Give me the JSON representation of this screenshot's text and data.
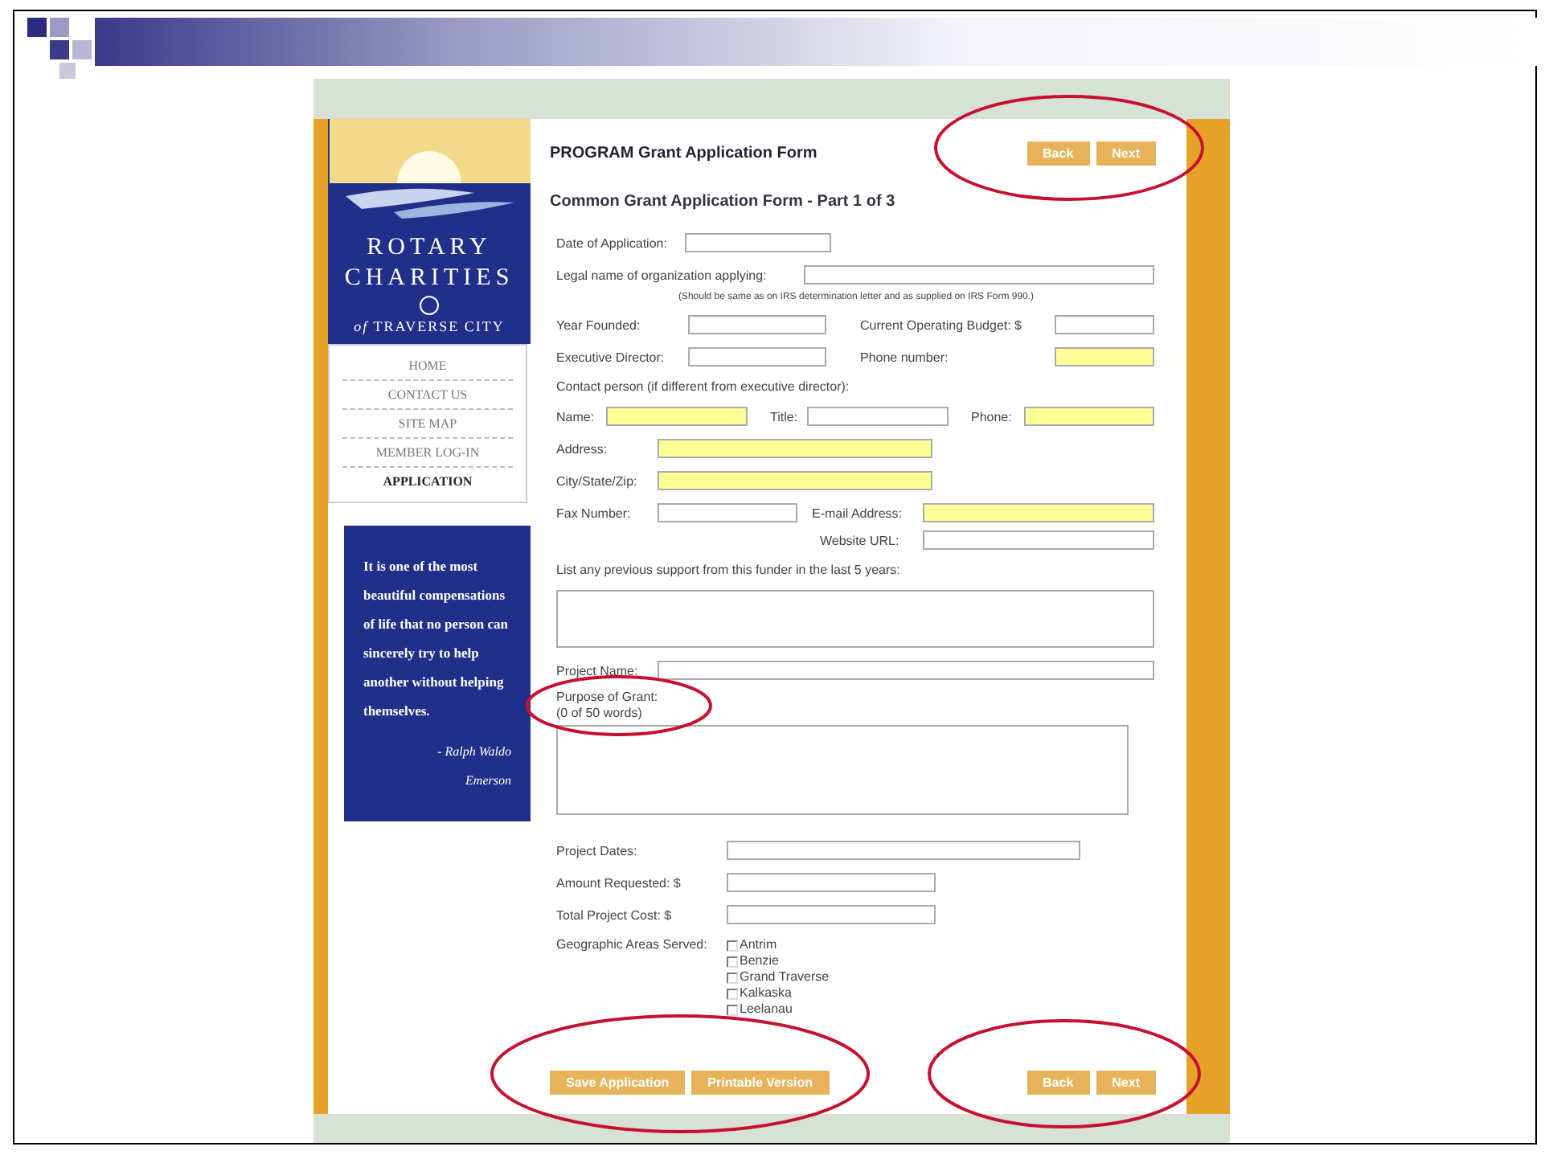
{
  "site": {
    "logo": {
      "line1": "ROTARY",
      "line2": "CHARITIES",
      "line3": "*of* TRAVERSE CITY"
    },
    "nav": [
      {
        "label": "HOME",
        "selected": false
      },
      {
        "label": "CONTACT US",
        "selected": false
      },
      {
        "label": "SITE MAP",
        "selected": false
      },
      {
        "label": "MEMBER LOG-IN",
        "selected": false
      },
      {
        "label": "APPLICATION",
        "selected": true
      }
    ],
    "quote": {
      "text": "It is one of the most beautiful compensations of life that no person can sincerely try to help another without helping themselves.",
      "author": "- Ralph Waldo Emerson"
    }
  },
  "form": {
    "title": "PROGRAM Grant Application Form",
    "top_buttons": [
      "Back",
      "Next"
    ],
    "subtitle": "Common Grant Application Form - Part 1 of 3",
    "rows": [
      {
        "kind": "date",
        "items": [
          {
            "kind": "label",
            "text": "Date of Application:"
          },
          {
            "kind": "field",
            "highlighted": false
          }
        ]
      },
      {
        "kind": "legal",
        "items": [
          {
            "kind": "label",
            "text": "Legal name of organization applying:"
          },
          {
            "kind": "field",
            "highlighted": false
          }
        ]
      },
      {
        "kind": "note",
        "items": [
          {
            "kind": "note",
            "text": "(Should be same as on IRS determination letter and as supplied on IRS Form 990.)"
          }
        ]
      },
      {
        "kind": "pair",
        "items": [
          {
            "kind": "label",
            "text": "Year Founded:"
          },
          {
            "kind": "field",
            "highlighted": false
          },
          {
            "kind": "label",
            "text": "Current Operating Budget: $"
          },
          {
            "kind": "field",
            "highlighted": false
          }
        ]
      },
      {
        "kind": "pair",
        "items": [
          {
            "kind": "label",
            "text": "Executive Director:"
          },
          {
            "kind": "field",
            "highlighted": false
          },
          {
            "kind": "label",
            "text": "Phone number:"
          },
          {
            "kind": "field",
            "highlighted": true
          }
        ]
      },
      {
        "kind": "caption",
        "items": [
          {
            "kind": "label",
            "text": "Contact person (if different from executive director):"
          }
        ]
      },
      {
        "kind": "contact",
        "items": [
          {
            "kind": "label",
            "text": "Name:"
          },
          {
            "kind": "field",
            "highlighted": true
          },
          {
            "kind": "label",
            "text": "Title:"
          },
          {
            "kind": "field",
            "highlighted": false
          },
          {
            "kind": "label",
            "text": "Phone:"
          },
          {
            "kind": "field",
            "highlighted": true
          }
        ]
      },
      {
        "kind": "address",
        "items": [
          {
            "kind": "label",
            "text": "Address:"
          },
          {
            "kind": "field",
            "highlighted": true
          }
        ]
      },
      {
        "kind": "address",
        "items": [
          {
            "kind": "label",
            "text": "City/State/Zip:"
          },
          {
            "kind": "field",
            "highlighted": true
          }
        ]
      },
      {
        "kind": "fax",
        "items": [
          {
            "kind": "label",
            "text": "Fax Number:"
          },
          {
            "kind": "field",
            "highlighted": false
          },
          {
            "kind": "label",
            "text": "E-mail Address:"
          },
          {
            "kind": "field",
            "highlighted": true
          }
        ]
      },
      {
        "kind": "website",
        "items": [
          {
            "kind": "label",
            "text": "Website URL:"
          },
          {
            "kind": "field",
            "highlighted": false
          }
        ]
      },
      {
        "kind": "caption",
        "items": [
          {
            "kind": "label",
            "text": "List any previous support from this funder in the last 5 years:"
          }
        ]
      },
      {
        "kind": "support-box",
        "items": [
          {
            "kind": "textarea"
          }
        ]
      },
      {
        "kind": "address",
        "items": [
          {
            "kind": "label",
            "text": "Project Name:"
          },
          {
            "kind": "field",
            "highlighted": false
          }
        ]
      },
      {
        "kind": "purpose",
        "items": [
          {
            "kind": "label",
            "text": "Purpose of Grant:"
          },
          {
            "kind": "label",
            "text": "(0 of 50 words)"
          }
        ]
      },
      {
        "kind": "purpose-box",
        "items": [
          {
            "kind": "textarea"
          }
        ]
      },
      {
        "kind": "dates",
        "items": [
          {
            "kind": "label",
            "text": "Project Dates:"
          },
          {
            "kind": "field",
            "highlighted": false
          }
        ]
      },
      {
        "kind": "money",
        "items": [
          {
            "kind": "label",
            "text": "Amount Requested: $"
          },
          {
            "kind": "field",
            "highlighted": false
          }
        ]
      },
      {
        "kind": "money",
        "items": [
          {
            "kind": "label",
            "text": "Total Project Cost: $"
          },
          {
            "kind": "field",
            "highlighted": false
          }
        ]
      },
      {
        "kind": "areas",
        "items": [
          {
            "kind": "label",
            "text": "Geographic Areas Served:"
          },
          {
            "kind": "checklist",
            "options": [
              {
                "label": "Antrim",
                "checked": false
              },
              {
                "label": "Benzie",
                "checked": false
              },
              {
                "label": "Grand Traverse",
                "checked": false
              },
              {
                "label": "Kalkaska",
                "checked": false
              },
              {
                "label": "Leelanau",
                "checked": false
              }
            ]
          }
        ]
      }
    ],
    "bottom_left_buttons": [
      "Save Application",
      "Printable Version"
    ],
    "bottom_right_buttons": [
      "Back",
      "Next"
    ]
  }
}
